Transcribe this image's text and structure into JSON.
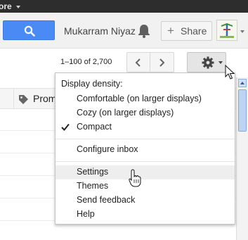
{
  "topbar": {
    "more_label": "ore"
  },
  "header": {
    "username": "Mukarram Niyaz",
    "share_label": "Share",
    "share_plus": "+"
  },
  "toolbar": {
    "page_count": "1–100 of 2,700"
  },
  "tabs": {
    "promotions_label": "Prom"
  },
  "settings_menu": {
    "density_heading": "Display density:",
    "density_options": [
      {
        "label": "Comfortable (on larger displays)",
        "checked": false
      },
      {
        "label": "Cozy (on larger displays)",
        "checked": false
      },
      {
        "label": "Compact",
        "checked": true
      }
    ],
    "configure_inbox": "Configure inbox",
    "items": [
      {
        "label": "Settings",
        "highlighted": true
      },
      {
        "label": "Themes",
        "highlighted": false
      },
      {
        "label": "Send feedback",
        "highlighted": false
      },
      {
        "label": "Help",
        "highlighted": false
      }
    ]
  },
  "colors": {
    "search_button": "#4a8af4",
    "topbar": "#2d2d2d",
    "menu_hover": "#eeeeee"
  }
}
